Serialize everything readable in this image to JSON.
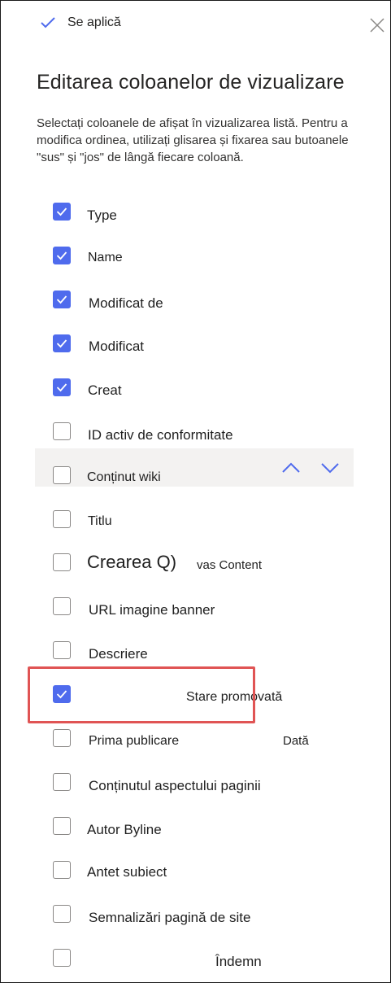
{
  "toolbar": {
    "apply_label": "Se aplică"
  },
  "panel": {
    "title": "Editarea coloanelor de vizualizare",
    "description": "Selectați coloanele de afișat în vizualizarea listă. Pentru a modifica ordinea, utilizați glisarea și fixarea sau butoanele \"sus\" și \"jos\" de lângă fiecare coloană."
  },
  "columns": [
    {
      "label": "Type",
      "checked": true
    },
    {
      "label": "Name",
      "checked": true
    },
    {
      "label": "Modificat de",
      "checked": true
    },
    {
      "label": "Modificat",
      "checked": true
    },
    {
      "label": "Creat",
      "checked": true
    },
    {
      "label": "ID activ de conformitate",
      "checked": false
    },
    {
      "label": "Conținut wiki",
      "checked": false
    },
    {
      "label": "Titlu",
      "checked": false
    },
    {
      "label": "Crearea Q)",
      "label_extra": "vas Content",
      "checked": false
    },
    {
      "label": "URL imagine banner",
      "checked": false
    },
    {
      "label": "Descriere",
      "checked": false
    },
    {
      "label": "Stare promovată",
      "checked": true
    },
    {
      "label": "Prima publicare",
      "label_extra": "Dată",
      "checked": false
    },
    {
      "label": "Conținutul aspectului paginii",
      "checked": false
    },
    {
      "label": "Autor Byline",
      "checked": false
    },
    {
      "label": "Antet subiect",
      "checked": false
    },
    {
      "label": "Semnalizări pagină de site",
      "checked": false
    },
    {
      "label": "Îndemn",
      "checked": false
    }
  ],
  "colors": {
    "accent": "#4f6bed",
    "highlight": "#e05454"
  },
  "icons": {
    "apply": "checkmark-icon",
    "close": "close-icon",
    "move_up": "chevron-up-icon",
    "move_down": "chevron-down-icon"
  }
}
